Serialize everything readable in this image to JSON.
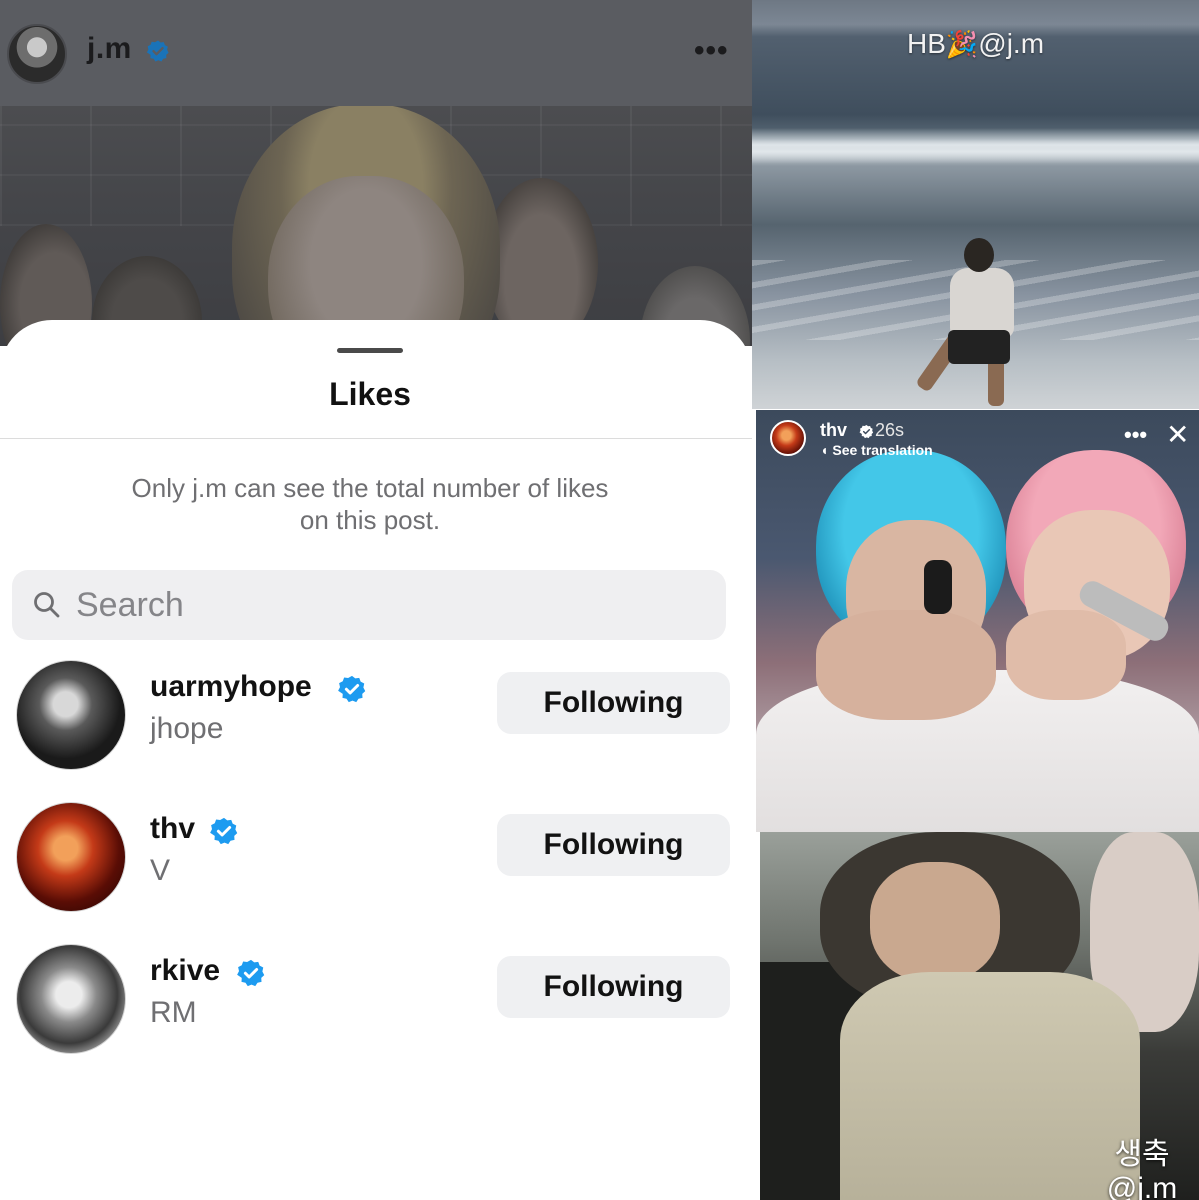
{
  "post": {
    "username": "j.m",
    "more_label": "•••"
  },
  "likes_sheet": {
    "title": "Likes",
    "notice_line1": "Only j.m can see the total number of likes",
    "notice_line2": "on this post.",
    "search_placeholder": "Search",
    "users": [
      {
        "handle": "uarmyhope",
        "name": "jhope",
        "verified": true,
        "button": "Following"
      },
      {
        "handle": "thv",
        "name": "V",
        "verified": true,
        "button": "Following"
      },
      {
        "handle": "rkive",
        "name": "RM",
        "verified": true,
        "button": "Following"
      }
    ]
  },
  "beach_story": {
    "caption_prefix": "HB",
    "caption_mention": "@j.m",
    "emoji_icon": "party-popper-icon"
  },
  "thv_story": {
    "username": "thv",
    "time": "26s",
    "translate": "See translation",
    "more_label": "•••",
    "close_label": "✕"
  },
  "car_story": {
    "caption_line1": "생축",
    "caption_line2": "@j.m"
  },
  "colors": {
    "verified_blue": "#1d9bf0",
    "button_bg": "#eff0f2",
    "search_bg": "#efeff1"
  }
}
